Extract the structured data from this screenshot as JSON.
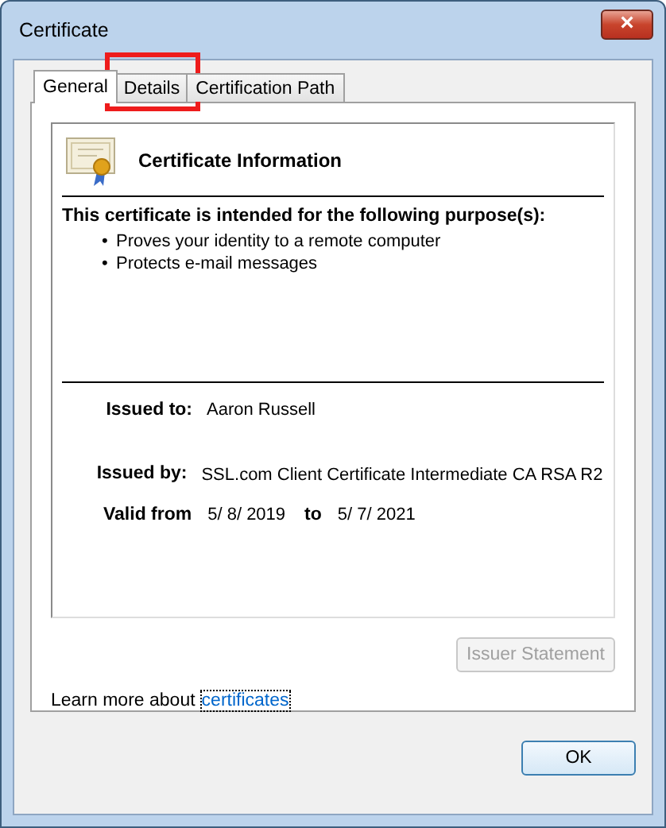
{
  "window": {
    "title": "Certificate",
    "close": "×"
  },
  "tabs": [
    {
      "label": "General",
      "selected": true
    },
    {
      "label": "Details",
      "selected": false,
      "highlighted": true
    },
    {
      "label": "Certification Path",
      "selected": false
    }
  ],
  "info": {
    "title": "Certificate Information",
    "purpose_heading": "This certificate is intended for the following purpose(s):",
    "bullet": "•",
    "purposes": [
      "Proves your identity to a remote computer",
      "Protects e-mail messages"
    ],
    "issued_to_label": "Issued to:",
    "issued_to": "Aaron Russell",
    "issued_by_label": "Issued by:",
    "issued_by": "SSL.com Client Certificate Intermediate CA RSA R2",
    "valid_from_label": "Valid from",
    "valid_from": "5/ 8/ 2019",
    "to_label": "to",
    "valid_to": "5/ 7/ 2021"
  },
  "issuer_statement": {
    "label": "Issuer Statement",
    "disabled": true
  },
  "learn_more": {
    "text": "Learn more about",
    "link": "certificates"
  },
  "buttons": [
    {
      "label": "OK"
    }
  ]
}
